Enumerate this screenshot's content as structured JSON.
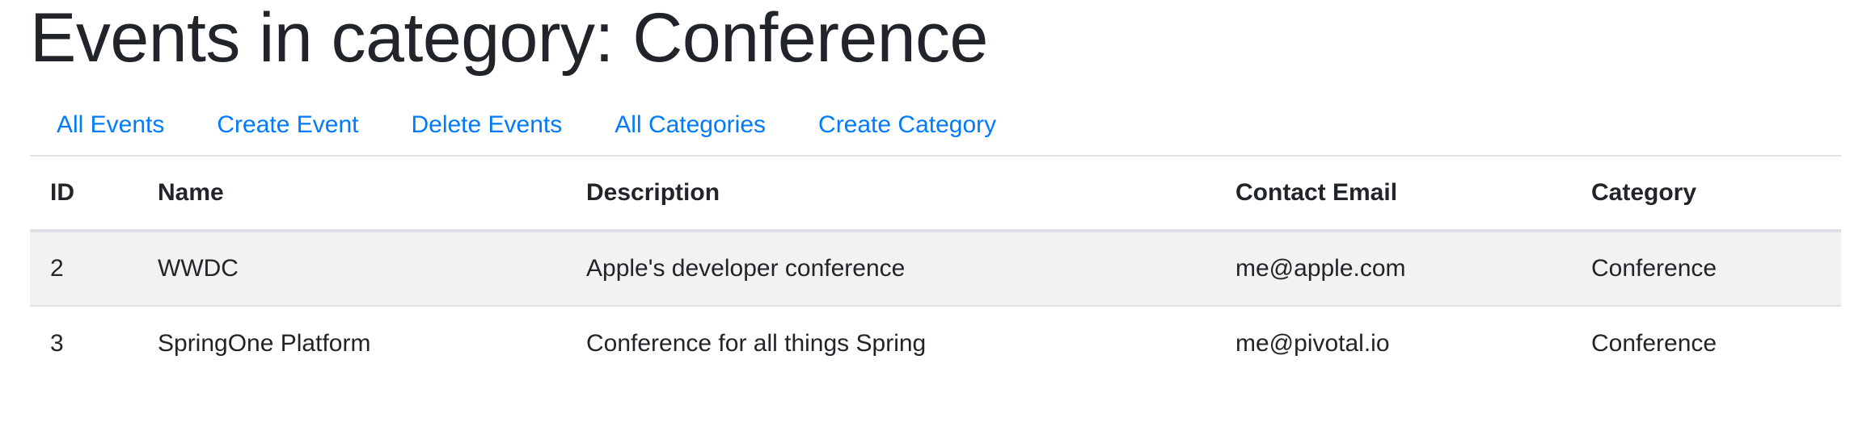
{
  "page": {
    "title": "Events in category: Conference"
  },
  "nav": {
    "items": [
      {
        "label": "All Events"
      },
      {
        "label": "Create Event"
      },
      {
        "label": "Delete Events"
      },
      {
        "label": "All Categories"
      },
      {
        "label": "Create Category"
      }
    ]
  },
  "table": {
    "headers": {
      "id": "ID",
      "name": "Name",
      "description": "Description",
      "contact_email": "Contact Email",
      "category": "Category"
    },
    "rows": [
      {
        "id": "2",
        "name": "WWDC",
        "description": "Apple's developer conference",
        "contact_email": "me@apple.com",
        "category": "Conference"
      },
      {
        "id": "3",
        "name": "SpringOne Platform",
        "description": "Conference for all things Spring",
        "contact_email": "me@pivotal.io",
        "category": "Conference"
      }
    ]
  },
  "colors": {
    "link": "#007bff",
    "text": "#212529",
    "stripe": "#f2f2f2",
    "border": "#dee2e6"
  }
}
